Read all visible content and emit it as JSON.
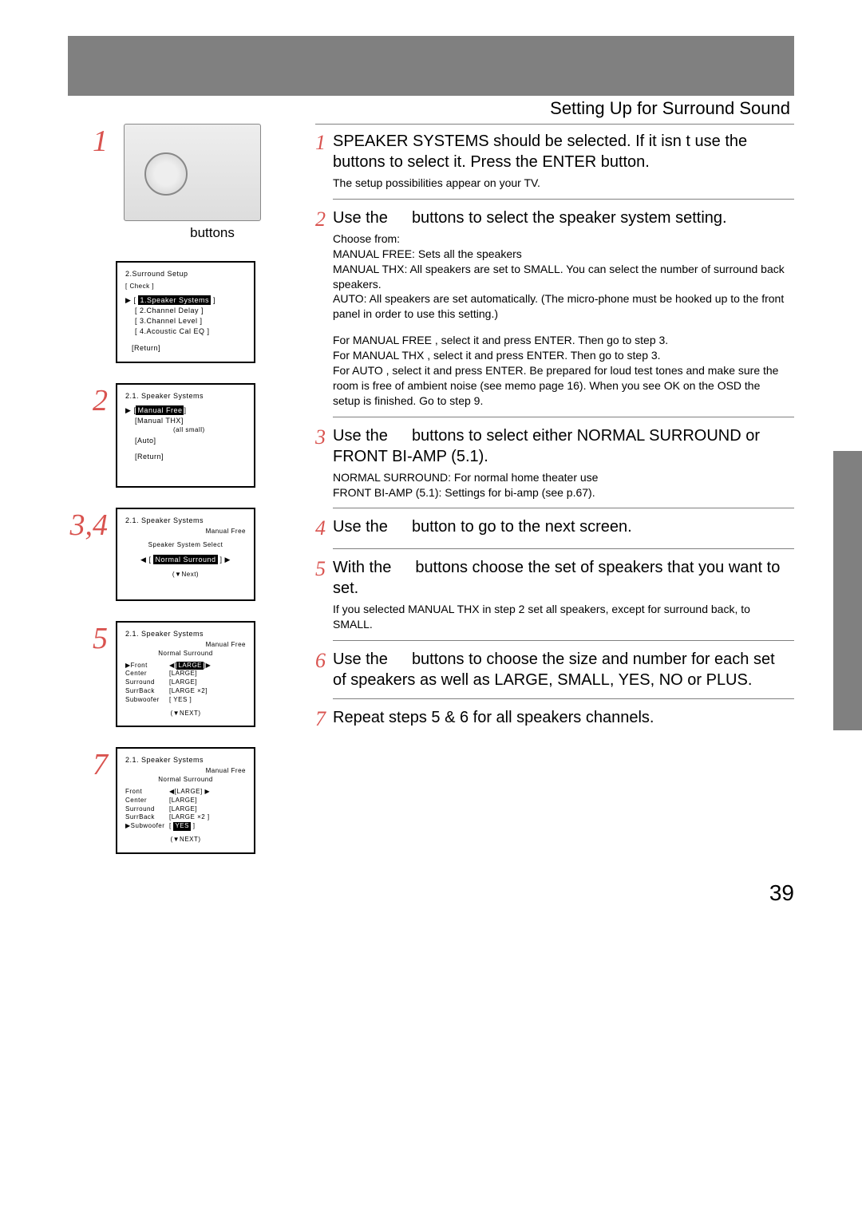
{
  "section_title": "Setting Up for Surround Sound",
  "page_number": "39",
  "left": {
    "step1": {
      "num": "1",
      "buttons_label": "buttons"
    },
    "osd1": {
      "title": "2.Surround Setup",
      "check": "[ Check ]",
      "items": [
        "1.Speaker Systems",
        "[ 2.Channel Delay ]",
        "[ 3.Channel Level ]",
        "[ 4.Acoustic Cal EQ ]"
      ],
      "return": "[Return]"
    },
    "step2": {
      "num": "2"
    },
    "osd2": {
      "title": "2.1. Speaker Systems",
      "items": [
        "Manual Free",
        "[Manual THX]",
        "(all small)",
        "[Auto]"
      ],
      "return": "[Return]"
    },
    "step34": {
      "num": "3,4"
    },
    "osd3": {
      "title": "2.1. Speaker Systems",
      "sub": "Manual Free",
      "line": "Speaker System Select",
      "sel": "Normal Surround",
      "next": "(▼Next)"
    },
    "step5": {
      "num": "5"
    },
    "osd5": {
      "title": "2.1. Speaker Systems",
      "sub1": "Manual Free",
      "sub2": "Normal Surround",
      "rows": [
        {
          "c1": "▶Front",
          "c2": "◀[",
          "hl": "LARGE",
          "c3": "]▶"
        },
        {
          "c1": " Center",
          "c2": "[LARGE]"
        },
        {
          "c1": " Surround",
          "c2": "[LARGE]"
        },
        {
          "c1": " SurrBack",
          "c2": "[LARGE ×2]"
        },
        {
          "c1": " Subwoofer",
          "c2": "[ YES ]"
        }
      ],
      "next": "(▼NEXT)"
    },
    "step7": {
      "num": "7"
    },
    "osd7": {
      "title": "2.1. Speaker Systems",
      "sub1": "Manual Free",
      "sub2": "Normal Surround",
      "rows": [
        {
          "c1": " Front",
          "c2": "◀[LARGE] ▶"
        },
        {
          "c1": " Center",
          "c2": "[LARGE]"
        },
        {
          "c1": " Surround",
          "c2": "[LARGE]"
        },
        {
          "c1": " SurrBack",
          "c2": "[LARGE ×2 ]"
        },
        {
          "c1": "▶Subwoofer",
          "c2": "[ ",
          "hl": "YES",
          "c3": " ]"
        }
      ],
      "next": "(▼NEXT)"
    }
  },
  "right": {
    "steps": [
      {
        "n": "1",
        "main_pre": "SPEAKER SYSTEMS should be selected. If it isn t use the",
        "gap": true,
        "main_post": "buttons to select it. Press the ENTER button.",
        "small": "The setup possibilities appear on your TV."
      },
      {
        "n": "2",
        "main_pre": "Use the",
        "gap": true,
        "main_post": "buttons to select the speaker system setting.",
        "small": "Choose from:\nMANUAL FREE: Sets all the speakers\nMANUAL THX: All speakers are set to SMALL. You can select the number of surround back speakers.\nAUTO: All speakers are set automatically. (The micro-phone must be hooked up to the front panel in order to use this setting.)",
        "small2": "For MANUAL FREE , select it and press ENTER. Then go to step 3.\nFor MANUAL THX , select it and press ENTER. Then go to step 3.\nFor AUTO , select it and press ENTER. Be prepared for loud test tones and make sure the room is free of ambient noise (see memo page 16). When you see OK on the OSD the setup is finished. Go to step 9."
      },
      {
        "n": "3",
        "main_pre": "Use the",
        "gap": true,
        "main_post": "buttons to select either NORMAL SURROUND or FRONT BI-AMP (5.1).",
        "small": "NORMAL SURROUND: For normal home theater use\nFRONT BI-AMP (5.1): Settings for bi-amp (see p.67)."
      },
      {
        "n": "4",
        "main_pre": "Use the",
        "gap": true,
        "main_post": "button to go to the next screen."
      },
      {
        "n": "5",
        "main_pre": "With the",
        "gap": true,
        "main_post": "buttons choose the set of speakers that you want to set.",
        "small": "If you selected MANUAL THX in step 2 set all speakers, except for surround back, to SMALL."
      },
      {
        "n": "6",
        "main_pre": "Use the",
        "gap": true,
        "main_post": "buttons to choose the size and number for each set of speakers as well as LARGE, SMALL, YES, NO or PLUS."
      },
      {
        "n": "7",
        "main_pre": "Repeat steps 5 & 6 for all speakers channels.",
        "main_post": ""
      }
    ]
  }
}
